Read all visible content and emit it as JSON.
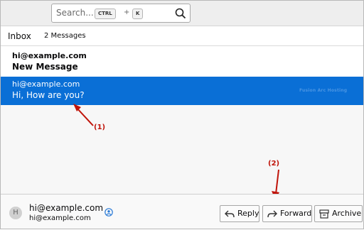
{
  "search": {
    "placeholder": "Search...",
    "shortcut_mod": "CTRL",
    "shortcut_plus": "+",
    "shortcut_key": "K"
  },
  "list_header": {
    "folder": "Inbox",
    "count": "2 Messages"
  },
  "messages": [
    {
      "from": "hi@example.com",
      "subject": "New Message",
      "unread": true,
      "selected": false
    },
    {
      "from": "hi@example.com",
      "subject": "Hi, How are you?",
      "unread": false,
      "selected": true
    }
  ],
  "watermark": "Fusion Arc Hosting",
  "annotations": {
    "one": "(1)",
    "two": "(2)"
  },
  "footer": {
    "avatar_letter": "H",
    "sender_name": "hi@example.com",
    "sender_email": "hi@example.com",
    "buttons": {
      "reply": "Reply",
      "forward": "Forward",
      "archive": "Archive"
    }
  },
  "icons": {
    "search": "search-icon",
    "contact": "contact-icon",
    "reply": "reply-icon",
    "forward": "forward-icon",
    "archive": "archive-icon"
  },
  "colors": {
    "selection": "#0a6fd6",
    "annotation": "#c0140a"
  }
}
